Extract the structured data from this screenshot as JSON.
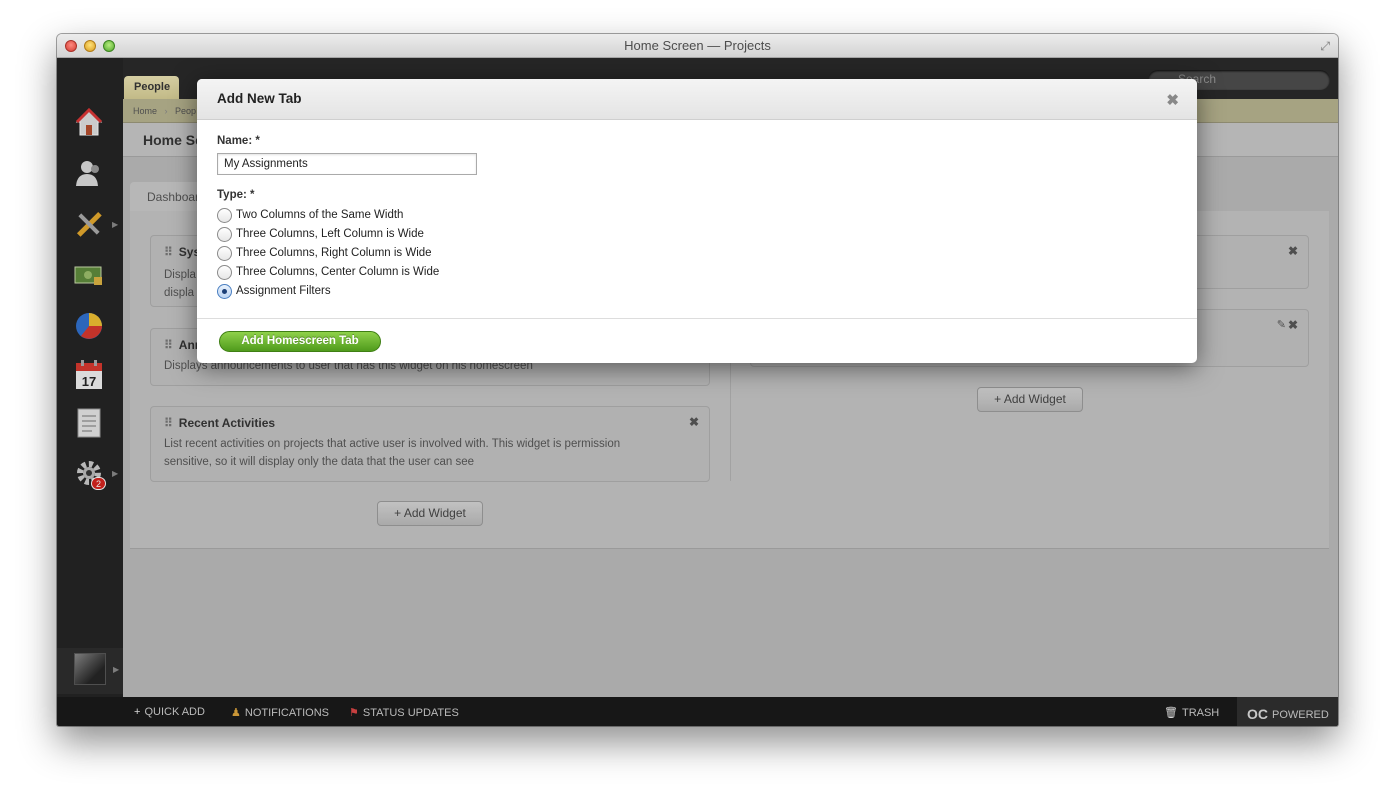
{
  "window": {
    "title": "Home Screen — Projects"
  },
  "topbar": {
    "people_tab": "People",
    "search_placeholder": "Search"
  },
  "breadcrumb": {
    "home": "Home",
    "people": "Peop"
  },
  "page": {
    "title": "Home Sc",
    "dashboard_tab": "Dashboar"
  },
  "sidebar": {
    "settings_badge": "2",
    "calendar_day": "17"
  },
  "widgets": {
    "system": {
      "title": "Syst",
      "desc": "Displa displa"
    },
    "announcements": {
      "title": "Ann",
      "desc": "Displays announcements to user that has this widget on his homescreen"
    },
    "recent": {
      "title": "Recent Activities",
      "desc": "List recent activities on projects that active user is involved with. This widget is permission sensitive, so it will display only the data that the user can see"
    },
    "add_widget_left": "+ Add Widget",
    "add_widget_right": "+ Add Widget"
  },
  "modal": {
    "title": "Add New Tab",
    "name_label": "Name: *",
    "name_value": "My Assignments",
    "type_label": "Type: *",
    "options": [
      {
        "label": "Two Columns of the Same Width",
        "checked": false
      },
      {
        "label": "Three Columns, Left Column is Wide",
        "checked": false
      },
      {
        "label": "Three Columns, Right Column is Wide",
        "checked": false
      },
      {
        "label": "Three Columns, Center Column is Wide",
        "checked": false
      },
      {
        "label": "Assignment Filters",
        "checked": true
      }
    ],
    "submit": "Add Homescreen Tab"
  },
  "bottombar": {
    "quick_add": "QUICK ADD",
    "notifications": "NOTIFICATIONS",
    "status_updates": "STATUS UPDATES",
    "trash": "TRASH",
    "powered": "POWERED"
  },
  "colors": {
    "accent_green": "#5aa826",
    "badge_red": "#d8201b",
    "radio_selected": "#1c3f77"
  }
}
